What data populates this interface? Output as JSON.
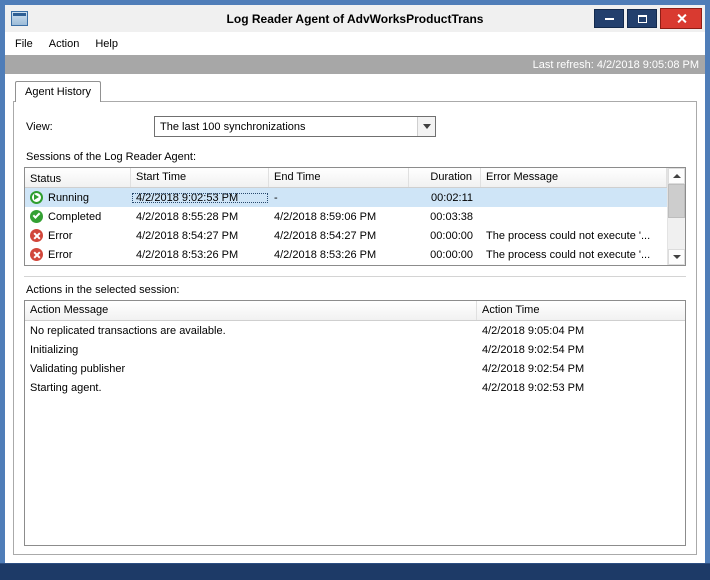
{
  "window": {
    "title": "Log Reader Agent of AdvWorksProductTrans",
    "menu": [
      "File",
      "Action",
      "Help"
    ],
    "last_refresh": "Last refresh: 4/2/2018 9:05:08 PM"
  },
  "tab": {
    "label": "Agent History"
  },
  "view": {
    "label": "View:",
    "value": "The last 100 synchronizations"
  },
  "sessions": {
    "label": "Sessions of the Log Reader Agent:",
    "columns": [
      "Status",
      "Start Time",
      "End Time",
      "Duration",
      "Error Message"
    ],
    "rows": [
      {
        "icon": "running-icon",
        "status": "Running",
        "start": "4/2/2018 9:02:53 PM",
        "end": "-",
        "duration": "00:02:11",
        "error": "",
        "selected": true
      },
      {
        "icon": "completed-icon",
        "status": "Completed",
        "start": "4/2/2018 8:55:28 PM",
        "end": "4/2/2018 8:59:06 PM",
        "duration": "00:03:38",
        "error": "",
        "selected": false
      },
      {
        "icon": "error-icon",
        "status": "Error",
        "start": "4/2/2018 8:54:27 PM",
        "end": "4/2/2018 8:54:27 PM",
        "duration": "00:00:00",
        "error": "The process could not execute '...",
        "selected": false
      },
      {
        "icon": "error-icon",
        "status": "Error",
        "start": "4/2/2018 8:53:26 PM",
        "end": "4/2/2018 8:53:26 PM",
        "duration": "00:00:00",
        "error": "The process could not execute '...",
        "selected": false
      }
    ]
  },
  "actions": {
    "label": "Actions in the selected session:",
    "columns": [
      "Action Message",
      "Action Time"
    ],
    "rows": [
      {
        "message": "No replicated transactions are available.",
        "time": "4/2/2018 9:05:04 PM"
      },
      {
        "message": "Initializing",
        "time": "4/2/2018 9:02:54 PM"
      },
      {
        "message": "Validating publisher",
        "time": "4/2/2018 9:02:54 PM"
      },
      {
        "message": "Starting agent.",
        "time": "4/2/2018 9:02:53 PM"
      }
    ]
  },
  "colors": {
    "frame": "#4f7db8",
    "frame_bottom": "#1d3a67",
    "selection": "#cfe5f7",
    "status_running": "#2f9e2f",
    "status_completed": "#33a033",
    "status_error": "#d1473b",
    "close_button": "#d93a30"
  }
}
